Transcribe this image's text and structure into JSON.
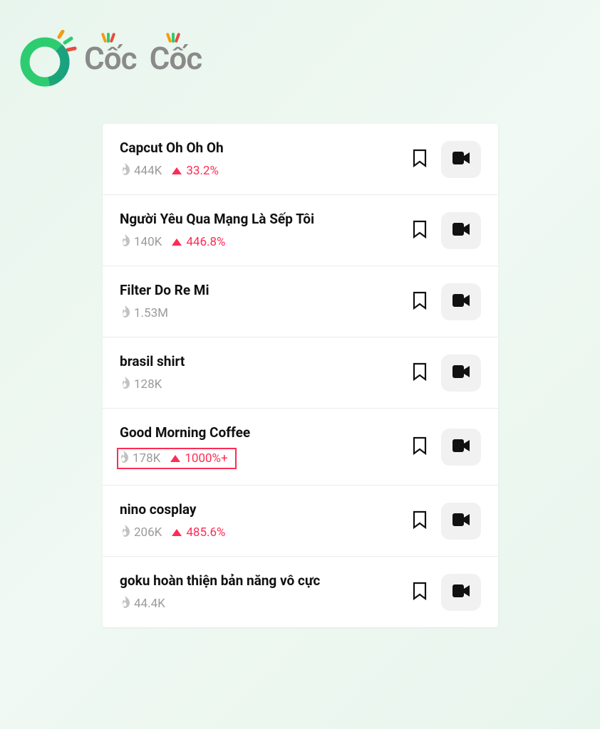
{
  "brand": {
    "word1": "Cốc",
    "word2": "Cốc"
  },
  "items": [
    {
      "title": "Capcut Oh Oh Oh",
      "views": "444K",
      "trend": "33.2%",
      "hasTrend": true,
      "highlighted": false
    },
    {
      "title": "Người Yêu Qua Mạng Là Sếp Tôi",
      "views": "140K",
      "trend": "446.8%",
      "hasTrend": true,
      "highlighted": false
    },
    {
      "title": "Filter Do Re Mi",
      "views": "1.53M",
      "trend": "",
      "hasTrend": false,
      "highlighted": false
    },
    {
      "title": "brasil shirt",
      "views": "128K",
      "trend": "",
      "hasTrend": false,
      "highlighted": false
    },
    {
      "title": "Good Morning Coffee",
      "views": "178K",
      "trend": "1000%+",
      "hasTrend": true,
      "highlighted": true
    },
    {
      "title": "nino cosplay",
      "views": "206K",
      "trend": "485.6%",
      "hasTrend": true,
      "highlighted": false
    },
    {
      "title": "goku hoàn thiện bản năng vô cực",
      "views": "44.4K",
      "trend": "",
      "hasTrend": false,
      "highlighted": false
    }
  ]
}
